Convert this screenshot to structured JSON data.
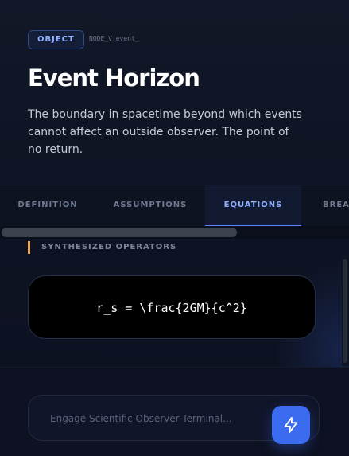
{
  "header": {
    "badge": "OBJECT",
    "node_id": "NODE_V.event_",
    "title": "Event Horizon",
    "description": "The boundary in spacetime beyond which events cannot affect an outside observer. The point of no return."
  },
  "tabs": [
    {
      "label": "DEFINITION",
      "active": false
    },
    {
      "label": "ASSUMPTIONS",
      "active": false
    },
    {
      "label": "EQUATIONS",
      "active": true
    },
    {
      "label": "BREA",
      "active": false
    }
  ],
  "section": {
    "label": "SYNTHESIZED OPERATORS",
    "equation": "r_s = \\frac{2GM}{c^2}"
  },
  "footer": {
    "input_placeholder": "Engage Scientific Observer Terminal...",
    "input_value": "",
    "send_icon": "lightning-bolt-icon"
  },
  "colors": {
    "accent": "#3b6cf0",
    "active_tab": "#8fb0ff",
    "section_marker": "#f0a64a",
    "background": "#0b0f1c"
  }
}
